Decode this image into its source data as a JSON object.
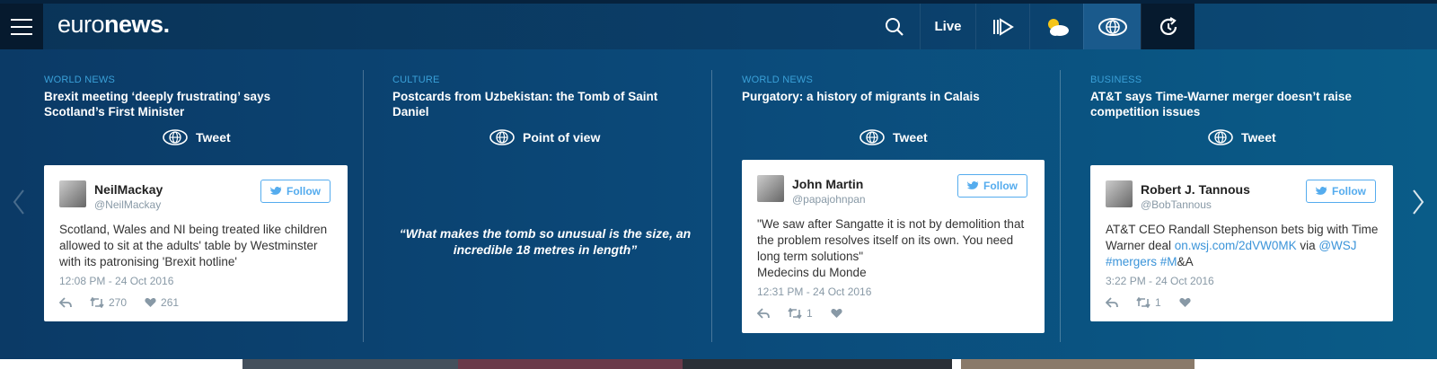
{
  "brand": {
    "logo_light": "euro",
    "logo_bold": "news."
  },
  "nav": {
    "live": "Live"
  },
  "columns": [
    {
      "category": "World news",
      "headline": "Brexit meeting ‘deeply frustrating’ says Scotland’s First Minister",
      "badge": "Tweet",
      "tweet": {
        "name": "NeilMackay",
        "handle": "@NeilMackay",
        "follow": "Follow",
        "text": "Scotland, Wales and NI being treated like children allowed to sit at the adults' table by Westminster with its patronising 'Brexit hotline'",
        "date": "12:08 PM - 24 Oct 2016",
        "retweets": "270",
        "likes": "261"
      }
    },
    {
      "category": "Culture",
      "headline": "Postcards from Uzbekistan: the Tomb of Saint Daniel",
      "badge": "Point of view",
      "quote": "“What makes the tomb so unusual is the size, an incredible 18 metres in length”"
    },
    {
      "category": "World news",
      "headline": "Purgatory: a history of migrants in Calais",
      "badge": "Tweet",
      "tweet": {
        "name": "John Martin",
        "handle": "@papajohnpan",
        "follow": "Follow",
        "text": "\"We saw after Sangatte it is not by demolition that the problem resolves itself on its own. You need long term solutions\"",
        "text2": "Medecins du Monde",
        "date": "12:31 PM - 24 Oct 2016",
        "retweets": "1",
        "likes": ""
      }
    },
    {
      "category": "Business",
      "headline": "AT&T says Time-Warner merger doesn’t raise competition issues",
      "badge": "Tweet",
      "tweet": {
        "name": "Robert J. Tannous",
        "handle": "@BobTannous",
        "follow": "Follow",
        "text_a": "AT&T CEO Randall Stephenson bets big with Time Warner deal ",
        "link1": "on.wsj.com/2dVW0MK",
        "text_b": " via ",
        "link2": "@WSJ",
        "text_c": " ",
        "link3": "#mergers",
        "text_d": " ",
        "link4": "#M",
        "text_e": "&A",
        "date": "3:22 PM - 24 Oct 2016",
        "retweets": "1",
        "likes": ""
      }
    }
  ],
  "colors": {
    "accent": "#3aa0d8",
    "twitter": "#55acee",
    "bg_dark": "#061a2e"
  },
  "icons": [
    "menu-icon",
    "search-icon",
    "video-icon",
    "weather-icon",
    "eye-icon",
    "latest-icon",
    "reply-icon",
    "retweet-icon",
    "heart-icon",
    "twitter-bird-icon",
    "chevron-left-icon",
    "chevron-right-icon"
  ]
}
